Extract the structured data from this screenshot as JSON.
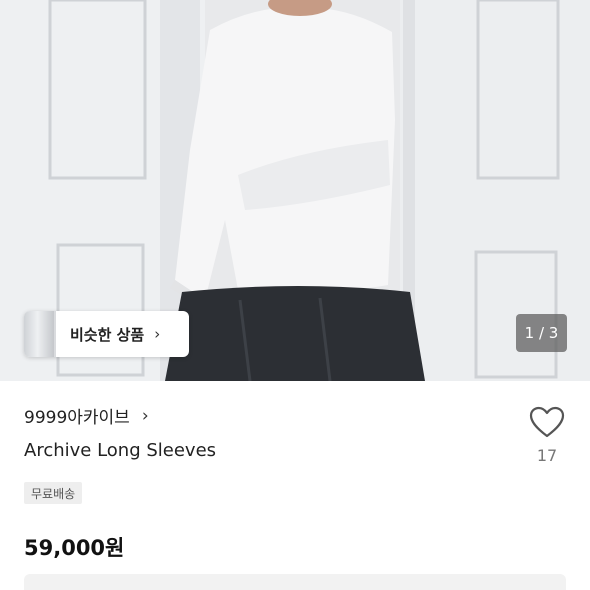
{
  "hero": {
    "similar_button_label": "비슷한 상품",
    "similar_button_chevron": "chevron-right-icon",
    "page_indicator": "1 / 3"
  },
  "product": {
    "shop_name": "9999아카이브",
    "shop_chevron": "chevron-right-icon",
    "title": "Archive Long Sleeves",
    "shipping_badge": "무료배송",
    "price": "59,000원"
  },
  "like": {
    "icon": "heart-outline-icon",
    "count": "17"
  }
}
